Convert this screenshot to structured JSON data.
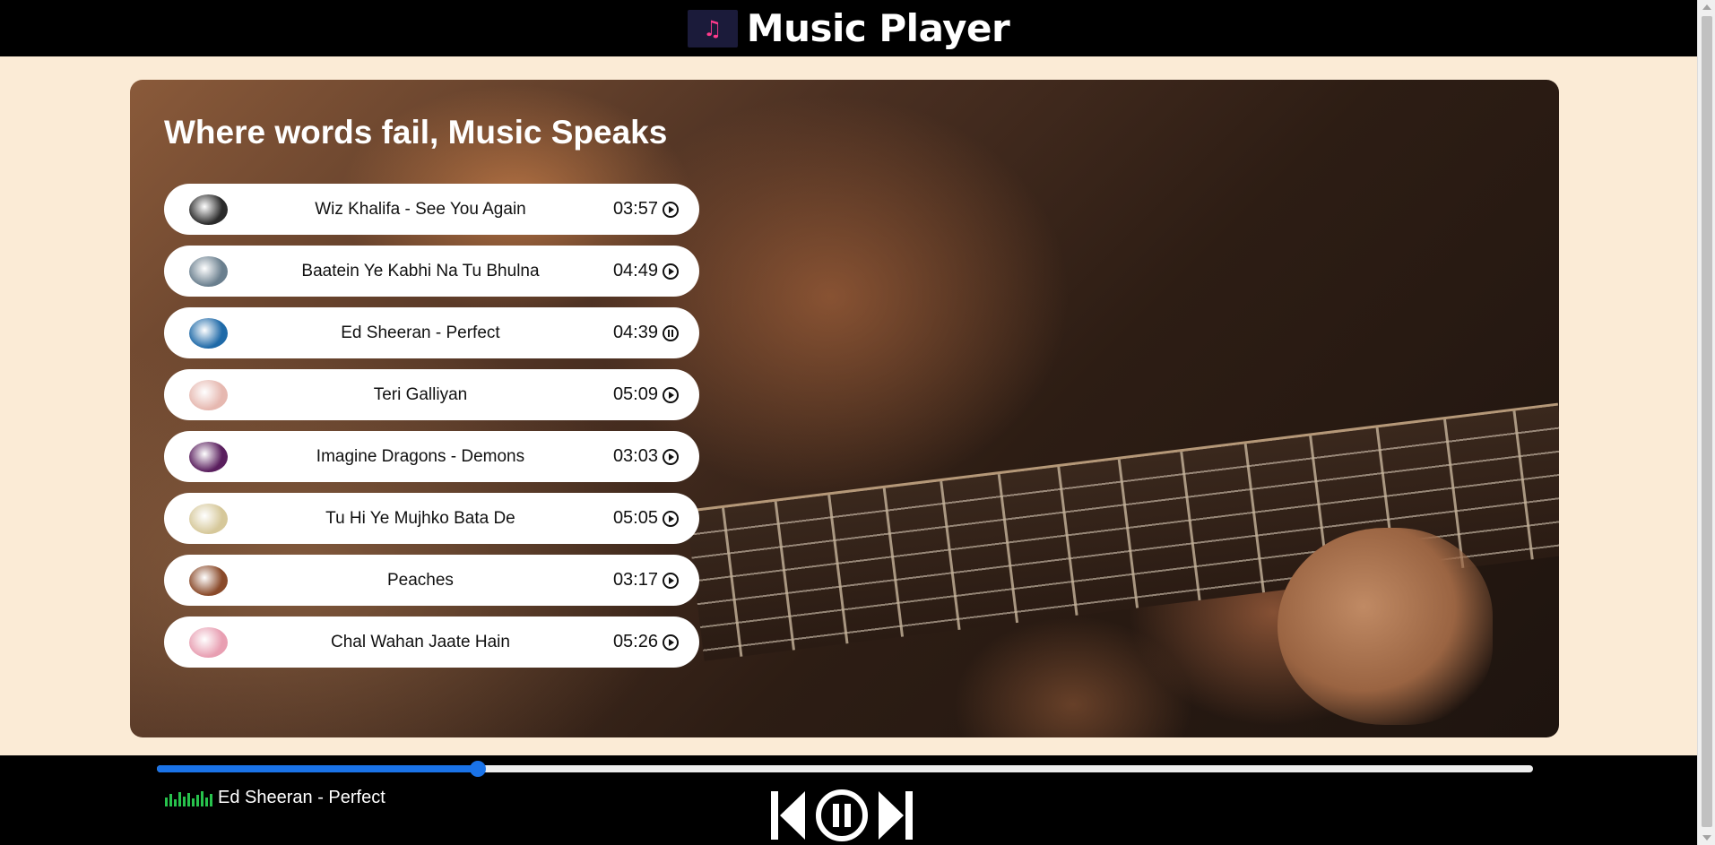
{
  "app": {
    "title": "Music Player",
    "logo_icon": "music-note-icon"
  },
  "hero": {
    "headline": "Where words fail, Music Speaks"
  },
  "songs": [
    {
      "title": "Wiz Khalifa - See You Again",
      "duration": "03:57",
      "state": "play",
      "cover_color": "#2b2b2b"
    },
    {
      "title": "Baatein Ye Kabhi Na Tu Bhulna",
      "duration": "04:49",
      "state": "play",
      "cover_color": "#6a7f8e"
    },
    {
      "title": "Ed Sheeran - Perfect",
      "duration": "04:39",
      "state": "pause",
      "cover_color": "#1f6aa8"
    },
    {
      "title": "Teri Galliyan",
      "duration": "05:09",
      "state": "play",
      "cover_color": "#e6b8b0"
    },
    {
      "title": "Imagine Dragons - Demons",
      "duration": "03:03",
      "state": "play",
      "cover_color": "#5a1f5e"
    },
    {
      "title": "Tu Hi Ye Mujhko Bata De",
      "duration": "05:05",
      "state": "play",
      "cover_color": "#d6c89a"
    },
    {
      "title": "Peaches",
      "duration": "03:17",
      "state": "play",
      "cover_color": "#8a4a2a"
    },
    {
      "title": "Chal Wahan Jaate Hain",
      "duration": "05:26",
      "state": "play",
      "cover_color": "#e89fb2"
    }
  ],
  "player": {
    "now_playing": "Ed Sheeran - Perfect",
    "progress": 0.233,
    "progress_color": "#1a73e8",
    "controls": [
      "previous-icon",
      "pause-icon",
      "next-icon"
    ]
  },
  "colors": {
    "page_bg": "#fbebd6",
    "bar_bg": "#000000",
    "equalizer": "#27c24c"
  }
}
